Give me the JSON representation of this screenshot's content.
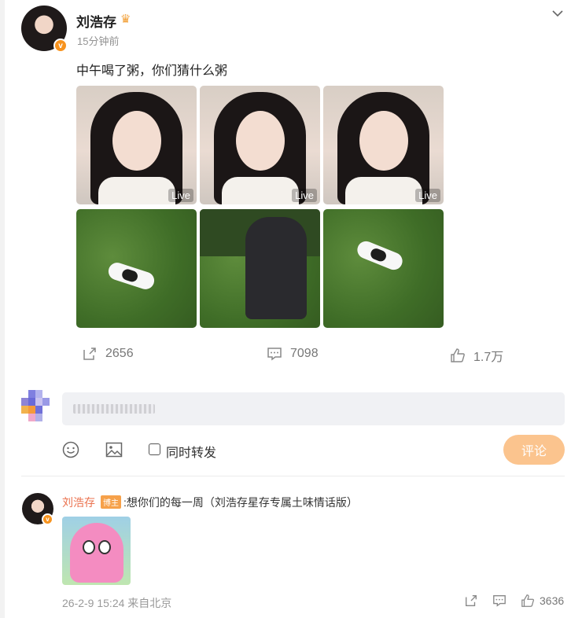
{
  "post": {
    "author": "刘浩存",
    "time": "15分钟前",
    "text": "中午喝了粥，你们猜什么粥",
    "live_label": "Live",
    "photos": [
      {
        "kind": "selfie-peace",
        "live": true
      },
      {
        "kind": "selfie-wink",
        "live": true
      },
      {
        "kind": "selfie-hands",
        "live": true
      },
      {
        "kind": "cat-on-lawn",
        "live": false
      },
      {
        "kind": "person-crouching",
        "live": false
      },
      {
        "kind": "cat-on-lawn",
        "live": false
      }
    ],
    "stats": {
      "reposts": "2656",
      "comments": "7098",
      "likes": "1.7万"
    }
  },
  "composer": {
    "repost_label": "同时转发",
    "submit_label": "评论"
  },
  "reply": {
    "author": "刘浩存",
    "badge": "博主",
    "text": ":想你们的每一周（刘浩存星存专属土味情话版）",
    "meta": "26-2-9 15:24 来自北京",
    "likes": "3636"
  },
  "colors": {
    "accent": "#eb7350",
    "vip": "#f7931e",
    "submit": "#fbc48e"
  }
}
